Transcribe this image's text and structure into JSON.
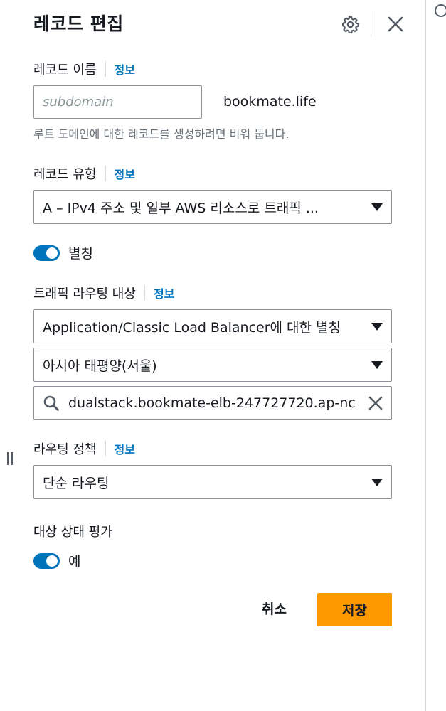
{
  "panel": {
    "title": "레코드 편집",
    "settings_icon": "gear-icon",
    "close_icon": "close-icon"
  },
  "record_name": {
    "label": "레코드 이름",
    "info": "정보",
    "placeholder": "subdomain",
    "domain_suffix": "bookmate.life",
    "help": "루트 도메인에 대한 레코드를 생성하려면 비워 둡니다."
  },
  "record_type": {
    "label": "레코드 유형",
    "info": "정보",
    "selected": "A – IPv4 주소 및 일부 AWS 리소스로 트래픽 ..."
  },
  "alias": {
    "label": "별칭",
    "enabled": true
  },
  "traffic_target": {
    "label": "트래픽 라우팅 대상",
    "info": "정보",
    "endpoint_type": "Application/Classic Load Balancer에 대한 별칭",
    "region": "아시아 태평양(서울)",
    "endpoint_value": "dualstack.bookmate-elb-247727720.ap-nc"
  },
  "routing_policy": {
    "label": "라우팅 정책",
    "info": "정보",
    "selected": "단순 라우팅"
  },
  "health_check": {
    "label": "대상 상태 평가",
    "toggle_label": "예",
    "enabled": true
  },
  "actions": {
    "cancel": "취소",
    "save": "저장"
  },
  "colors": {
    "accent": "#0073bb",
    "primary_button": "#ff9900"
  }
}
